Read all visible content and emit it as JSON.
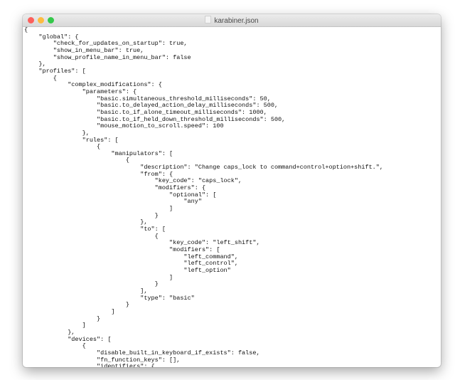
{
  "window": {
    "title": "karabiner.json"
  },
  "lines": [
    "{",
    "    \"global\": {",
    "        \"check_for_updates_on_startup\": true,",
    "        \"show_in_menu_bar\": true,",
    "        \"show_profile_name_in_menu_bar\": false",
    "    },",
    "    \"profiles\": [",
    "        {",
    "            \"complex_modifications\": {",
    "                \"parameters\": {",
    "                    \"basic.simultaneous_threshold_milliseconds\": 50,",
    "                    \"basic.to_delayed_action_delay_milliseconds\": 500,",
    "                    \"basic.to_if_alone_timeout_milliseconds\": 1000,",
    "                    \"basic.to_if_held_down_threshold_milliseconds\": 500,",
    "                    \"mouse_motion_to_scroll.speed\": 100",
    "                },",
    "                \"rules\": [",
    "                    {",
    "                        \"manipulators\": [",
    "                            {",
    "                                \"description\": \"Change caps_lock to command+control+option+shift.\",",
    "                                \"from\": {",
    "                                    \"key_code\": \"caps_lock\",",
    "                                    \"modifiers\": {",
    "                                        \"optional\": [",
    "                                            \"any\"",
    "                                        ]",
    "                                    }",
    "                                },",
    "                                \"to\": [",
    "                                    {",
    "                                        \"key_code\": \"left_shift\",",
    "                                        \"modifiers\": [",
    "                                            \"left_command\",",
    "                                            \"left_control\",",
    "                                            \"left_option\"",
    "                                        ]",
    "                                    }",
    "                                ],",
    "                                \"type\": \"basic\"",
    "                            }",
    "                        ]",
    "                    }",
    "                ]",
    "            },",
    "            \"devices\": [",
    "                {",
    "                    \"disable_built_in_keyboard_if_exists\": false,",
    "                    \"fn_function_keys\": [],",
    "                    \"identifiers\": {"
  ]
}
